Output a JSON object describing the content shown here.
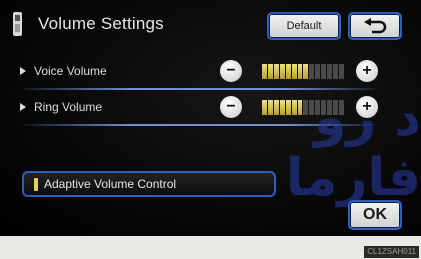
{
  "header": {
    "title": "Volume Settings"
  },
  "buttons": {
    "default_label": "Default",
    "ok_label": "OK"
  },
  "volume": {
    "rows": [
      {
        "label": "Voice Volume",
        "level": 0.6
      },
      {
        "label": "Ring Volume",
        "level": 0.5
      }
    ],
    "total_segments": 14
  },
  "adaptive": {
    "label": "Adaptive Volume Control",
    "enabled": true
  },
  "watermark": "د رو فارما",
  "image_code": "CL1ZSAH011",
  "colors": {
    "accent_border": "#2f5fb8",
    "level_on": "#e6d05a",
    "background": "#050505"
  }
}
